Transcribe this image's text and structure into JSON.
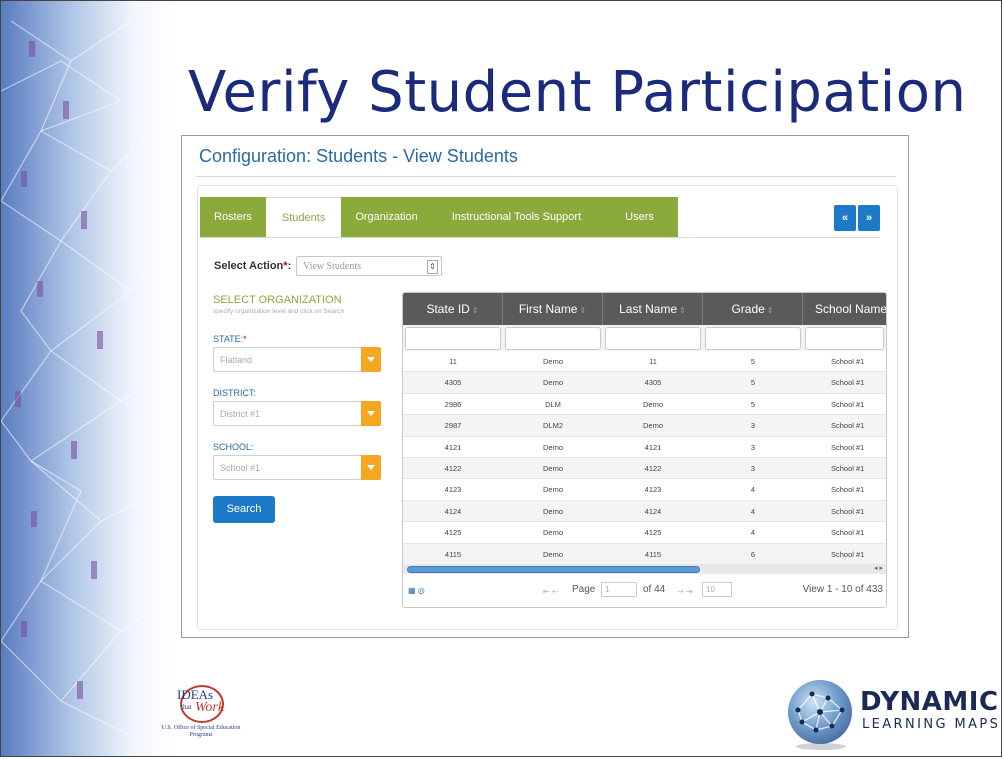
{
  "slide": {
    "title": "Verify Student Participation"
  },
  "app": {
    "title": "Configuration: Students - View Students",
    "tabs": [
      {
        "label": "Rosters",
        "active": false
      },
      {
        "label": "Students",
        "active": true
      },
      {
        "label": "Organization",
        "active": false
      },
      {
        "label": "Instructional Tools Support",
        "active": false
      },
      {
        "label": "Users",
        "active": false
      }
    ],
    "nav_prev": "«",
    "nav_next": "»",
    "select_action": {
      "label": "Select Action",
      "required_mark": "*",
      "colon": ":",
      "value": "View Students"
    },
    "organization": {
      "heading": "SELECT ORGANIZATION",
      "hint": "specify organization level and click on Search",
      "state_label": "STATE:",
      "state_required": "*",
      "state_value": "Flatland",
      "district_label": "DISTRICT:",
      "district_value": "District #1",
      "school_label": "SCHOOL:",
      "school_value": "School #1",
      "search_button": "Search"
    },
    "grid": {
      "columns": [
        "State ID",
        "First Name",
        "Last Name",
        "Grade",
        "School Name"
      ],
      "rows": [
        [
          "11",
          "Demo",
          "11",
          "5",
          "School #1"
        ],
        [
          "4305",
          "Demo",
          "4305",
          "5",
          "School #1"
        ],
        [
          "2986",
          "DLM",
          "Demo",
          "5",
          "School #1"
        ],
        [
          "2987",
          "DLM2",
          "Demo",
          "3",
          "School #1"
        ],
        [
          "4121",
          "Demo",
          "4121",
          "3",
          "School #1"
        ],
        [
          "4122",
          "Demo",
          "4122",
          "3",
          "School #1"
        ],
        [
          "4123",
          "Demo",
          "4123",
          "4",
          "School #1"
        ],
        [
          "4124",
          "Demo",
          "4124",
          "4",
          "School #1"
        ],
        [
          "4125",
          "Demo",
          "4125",
          "4",
          "School #1"
        ],
        [
          "4115",
          "Demo",
          "4115",
          "6",
          "School #1"
        ]
      ],
      "pager": {
        "page_label": "Page",
        "page_value": "1",
        "of_label": "of 44",
        "per_page": "10",
        "view_info": "View 1 - 10 of 433"
      }
    }
  },
  "logos": {
    "ideas_main": "IDEAs",
    "ideas_that": "that",
    "ideas_work": "Work",
    "ideas_sub": "U.S. Office of Special Education Programs",
    "dlm_name": "DYNAMIC",
    "dlm_sub": "LEARNING MAPS"
  }
}
